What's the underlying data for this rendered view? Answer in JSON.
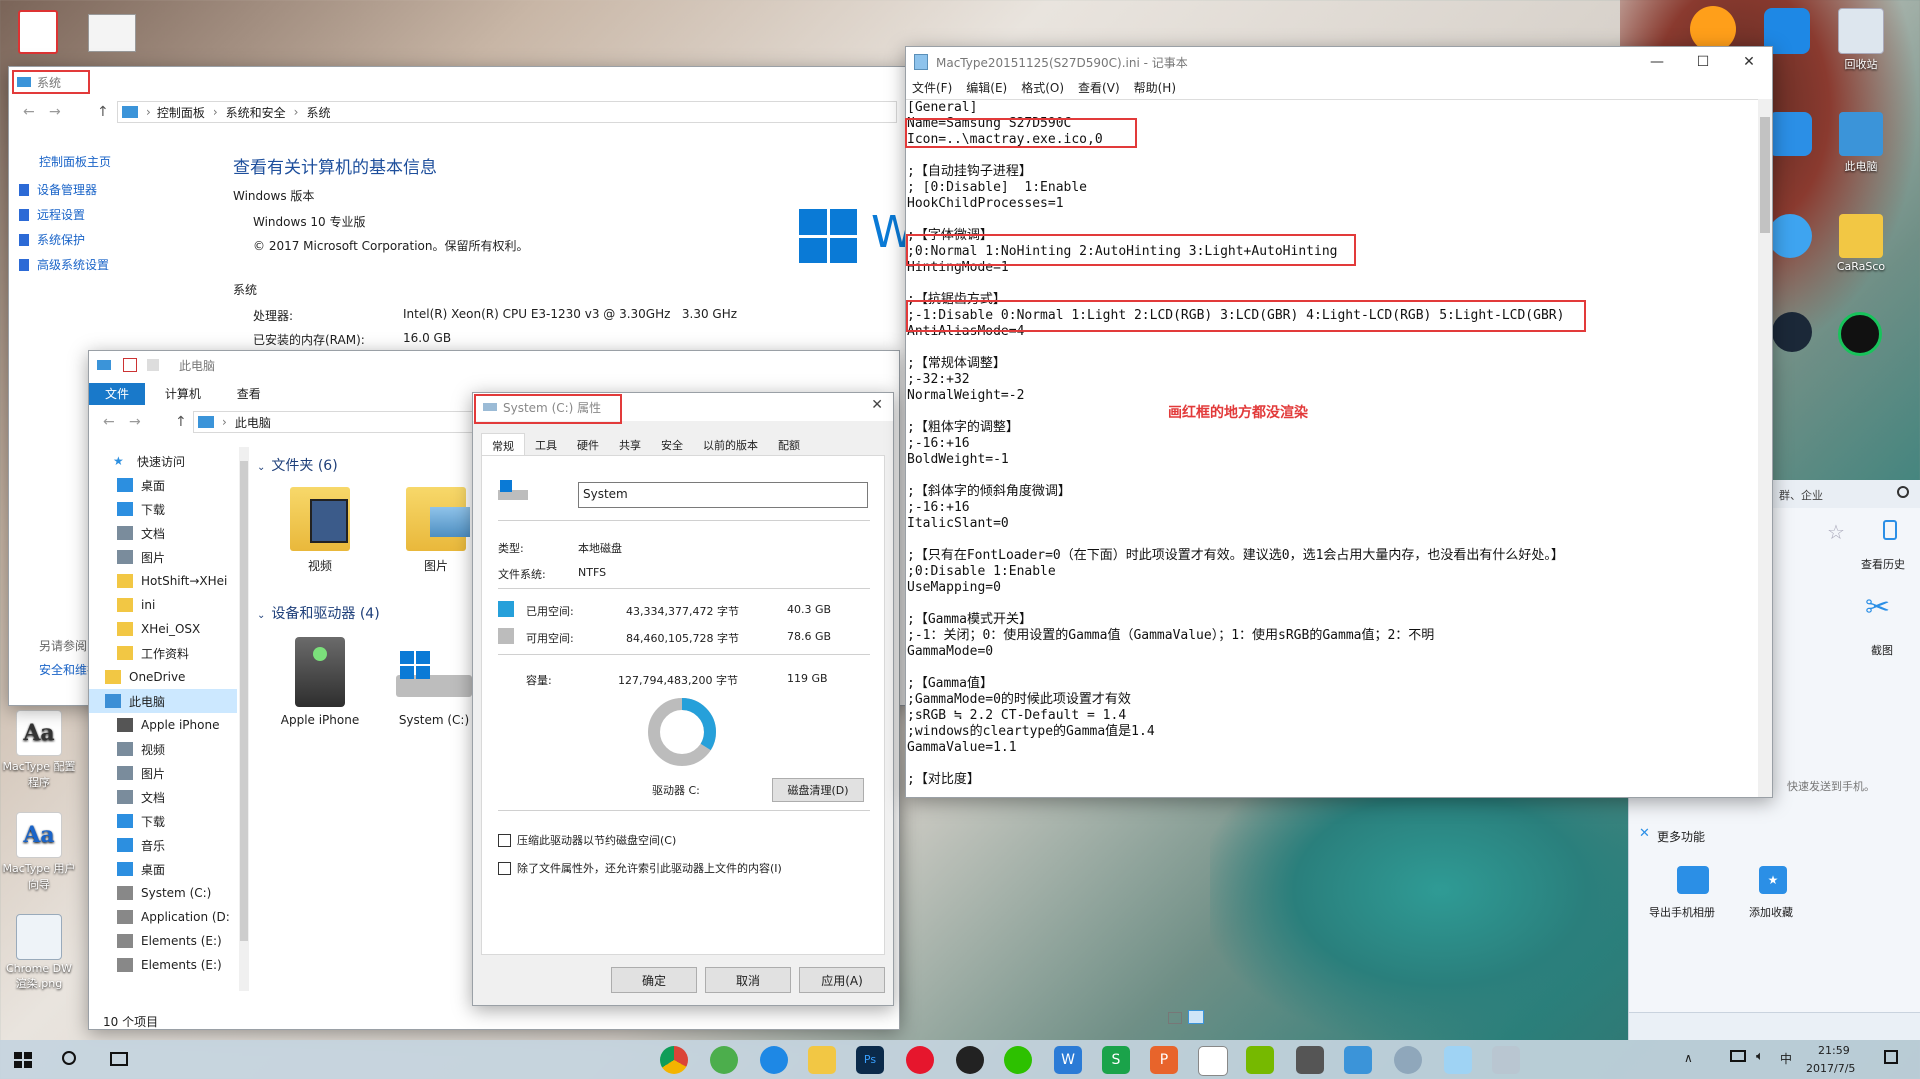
{
  "desktop": {
    "icons_left": [
      {
        "label": "MacType 配置程序"
      },
      {
        "label": "MacType 用户向导"
      },
      {
        "label": "Chrome DW 渲染.png"
      }
    ],
    "icons_right": [
      {
        "label": "回收站"
      },
      {
        "label": "此电脑"
      },
      {
        "label": "CaRaSco"
      }
    ],
    "annotation": "画红框的地方都没渲染"
  },
  "system_window": {
    "title": "系统",
    "breadcrumb": [
      "控制面板",
      "系统和安全",
      "系统"
    ],
    "sidebar": {
      "home": "控制面板主页",
      "links": [
        "设备管理器",
        "远程设置",
        "系统保护",
        "高级系统设置"
      ],
      "see_also": "另请参阅",
      "see_also_item": "安全和维护"
    },
    "heading": "查看有关计算机的基本信息",
    "edition_section": "Windows 版本",
    "edition": "Windows 10 专业版",
    "copyright": "© 2017 Microsoft Corporation。保留所有权利。",
    "system_section": "系统",
    "rows": [
      {
        "label": "处理器:",
        "value": "Intel(R) Xeon(R) CPU E3-1230 v3 @ 3.30GHz   3.30 GHz"
      },
      {
        "label": "已安装的内存(RAM):",
        "value": "16.0 GB"
      }
    ]
  },
  "explorer": {
    "title": "此电脑",
    "ribbon_tabs": [
      "文件",
      "计算机",
      "查看"
    ],
    "address": "此电脑",
    "quick_access": "快速访问",
    "nav": [
      {
        "label": "桌面",
        "color": "#2c8fe0"
      },
      {
        "label": "下载",
        "color": "#2c8fe0"
      },
      {
        "label": "文档",
        "color": "#7a8c9c"
      },
      {
        "label": "图片",
        "color": "#7a8c9c"
      },
      {
        "label": "HotShift→XHei",
        "color": "#f2c744"
      },
      {
        "label": "ini",
        "color": "#f2c744"
      },
      {
        "label": "XHei_OSX",
        "color": "#f2c744"
      },
      {
        "label": "工作资料",
        "color": "#f2c744"
      },
      {
        "label": "OneDrive",
        "color": "#f2c744"
      },
      {
        "label": "此电脑",
        "color": "#3c8fd6"
      },
      {
        "label": "Apple iPhone",
        "color": "#555555"
      },
      {
        "label": "视频",
        "color": "#7a8c9c"
      },
      {
        "label": "图片",
        "color": "#7a8c9c"
      },
      {
        "label": "文档",
        "color": "#7a8c9c"
      },
      {
        "label": "下载",
        "color": "#2c8fe0"
      },
      {
        "label": "音乐",
        "color": "#2c8fe0"
      },
      {
        "label": "桌面",
        "color": "#2c8fe0"
      },
      {
        "label": "System (C:)",
        "color": "#888888"
      },
      {
        "label": "Application (D:",
        "color": "#888888"
      },
      {
        "label": "Elements (E:)",
        "color": "#888888"
      },
      {
        "label": "Elements (E:)",
        "color": "#888888"
      }
    ],
    "folders_header": "文件夹 (6)",
    "folders": [
      "视频",
      "图片"
    ],
    "devices_header": "设备和驱动器 (4)",
    "devices": [
      "Apple iPhone",
      "System (C:)"
    ],
    "status": "10 个项目"
  },
  "properties": {
    "title": "System (C:) 属性",
    "tabs": [
      "常规",
      "工具",
      "硬件",
      "共享",
      "安全",
      "以前的版本",
      "配额"
    ],
    "name_value": "System",
    "type_label": "类型:",
    "type_value": "本地磁盘",
    "fs_label": "文件系统:",
    "fs_value": "NTFS",
    "used_label": "已用空间:",
    "used_bytes": "43,334,377,472 字节",
    "used_gb": "40.3 GB",
    "free_label": "可用空间:",
    "free_bytes": "84,460,105,728 字节",
    "free_gb": "78.6 GB",
    "cap_label": "容量:",
    "cap_bytes": "127,794,483,200 字节",
    "cap_gb": "119 GB",
    "used_fraction": 0.339,
    "used_color": "#26a0da",
    "free_color": "#bcbcbc",
    "drive_label": "驱动器 C:",
    "cleanup": "磁盘清理(D)",
    "compress": "压缩此驱动器以节约磁盘空间(C)",
    "index": "除了文件属性外，还允许索引此驱动器上文件的内容(I)",
    "ok": "确定",
    "cancel": "取消",
    "apply": "应用(A)"
  },
  "notepad": {
    "title": "MacType20151125(S27D590C).ini - 记事本",
    "menu": [
      "文件(F)",
      "编辑(E)",
      "格式(O)",
      "查看(V)",
      "帮助(H)"
    ],
    "lines": [
      "[General]",
      "Name=Samsung S27D590C",
      "Icon=..\\mactray.exe.ico,0",
      "",
      ";【自动挂钩子进程】",
      "; [0:Disable]  1:Enable",
      "HookChildProcesses=1",
      "",
      ";【字体微调】",
      ";0:Normal 1:NoHinting 2:AutoHinting 3:Light+AutoHinting",
      "HintingMode=1",
      "",
      ";【抗锯齿方式】",
      ";-1:Disable 0:Normal 1:Light 2:LCD(RGB) 3:LCD(GBR) 4:Light-LCD(RGB) 5:Light-LCD(GBR)",
      "AntiAliasMode=4",
      "",
      ";【常规体调整】",
      ";-32:+32",
      "NormalWeight=-2",
      "",
      ";【粗体字的调整】",
      ";-16:+16",
      "BoldWeight=-1",
      "",
      ";【斜体字的倾斜角度微调】",
      ";-16:+16",
      "ItalicSlant=0",
      "",
      ";【只有在FontLoader=0（在下面）时此项设置才有效。建议选0，选1会占用大量内存，也没看出有什么好处。】",
      ";0:Disable 1:Enable",
      "UseMapping=0",
      "",
      ";【Gamma模式开关】",
      ";-1：关闭；0：使用设置的Gamma值（GammaValue）；1：使用sRGB的Gamma值；2：不明",
      "GammaMode=0",
      "",
      ";【Gamma值】",
      ";GammaMode=0的时候此项设置才有效",
      ";sRGB ≒ 2.2 CT-Default = 1.4",
      ";windows的cleartype的Gamma值是1.4",
      "GammaValue=1.1",
      "",
      ";【对比度】"
    ]
  },
  "side_panel": {
    "search_hint": "群、企业",
    "history": "查看历史",
    "screenshot": "截图",
    "send_phone": "快速发送到手机。",
    "more": "更多功能",
    "export": "导出手机相册",
    "collect": "添加收藏"
  },
  "taskbar": {
    "time": "21:59",
    "date": "2017/7/5",
    "ime": "中"
  }
}
